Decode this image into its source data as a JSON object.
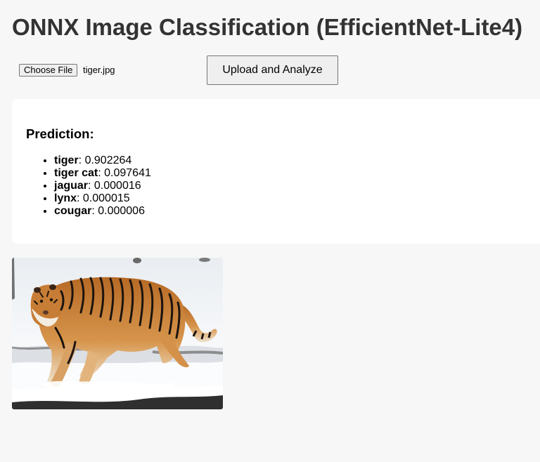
{
  "page": {
    "title": "ONNX Image Classification (EfficientNet-Lite4)"
  },
  "upload": {
    "choose_file_label": "Choose File",
    "file_name": "tiger.jpg",
    "submit_label": "Upload and Analyze"
  },
  "result": {
    "heading": "Prediction:",
    "predictions": [
      {
        "label": "tiger",
        "score": "0.902264"
      },
      {
        "label": "tiger cat",
        "score": "0.097641"
      },
      {
        "label": "jaguar",
        "score": "0.000016"
      },
      {
        "label": "lynx",
        "score": "0.000015"
      },
      {
        "label": "cougar",
        "score": "0.000006"
      }
    ]
  },
  "preview": {
    "subject": "tiger walking in snow"
  },
  "colors": {
    "page_background": "#f7f7f7",
    "card_background": "#ffffff",
    "title_text": "#333333"
  }
}
